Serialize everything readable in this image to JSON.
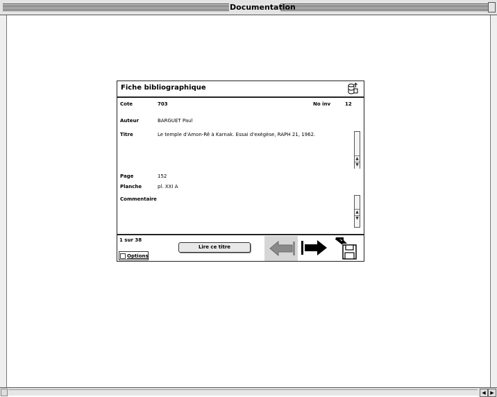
{
  "window": {
    "title": "Documentation"
  },
  "card": {
    "title": "Fiche bibliographique",
    "db_icon": "database-icon",
    "fields": {
      "cote_label": "Cote",
      "cote_value": "703",
      "noinv_label": "No inv",
      "noinv_value": "12",
      "auteur_label": "Auteur",
      "auteur_value": "BARGUET Paul",
      "titre_label": "Titre",
      "titre_value": "Le temple d'Amon-Rê à Karnak. Essai d'exégèse, RAPH 21, 1962.",
      "page_label": "Page",
      "page_value": "152",
      "planche_label": "Planche",
      "planche_value": "pl. XXI A",
      "commentaire_label": "Commentaire",
      "commentaire_value": ""
    },
    "footer": {
      "record_count": "1 sur 38",
      "read_button": "Lire ce titre",
      "options_label": "Options",
      "prev_icon": "arrow-left-icon",
      "next_icon": "arrow-right-icon",
      "save_icon": "save-disk-icon"
    }
  },
  "scrollbars": {
    "up_glyph": "▲",
    "down_glyph": "▼",
    "left_glyph": "◀",
    "right_glyph": "▶"
  }
}
